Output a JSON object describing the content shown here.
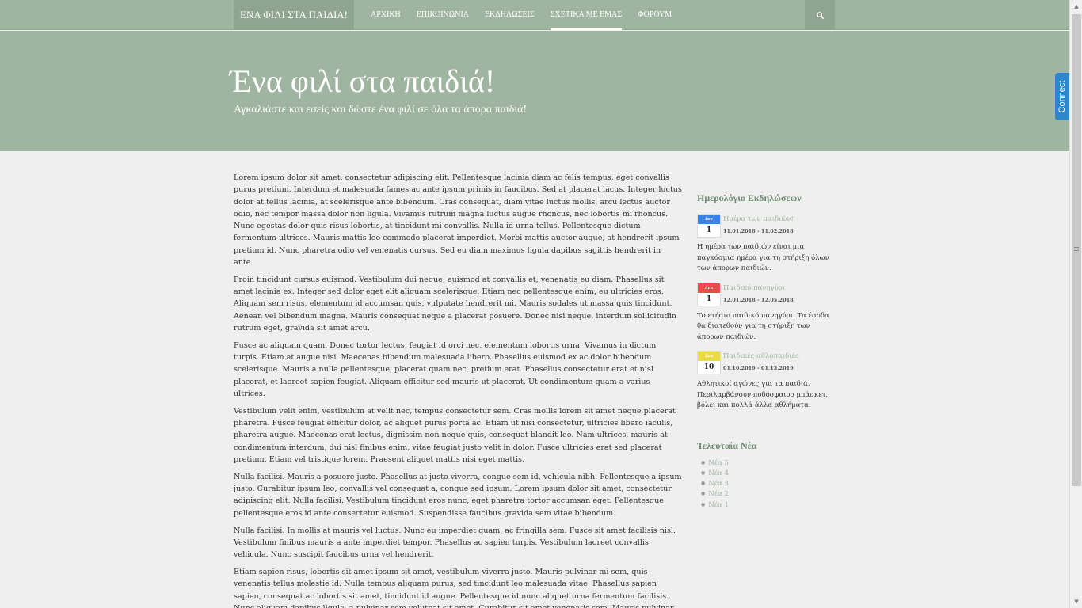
{
  "nav": {
    "brand": "ΕΝΑ ΦΙΛΙ ΣΤΑ ΠΑΙΔΙΑ!",
    "items": [
      {
        "label": "ΑΡΧΙΚΗ"
      },
      {
        "label": "ΕΠΙΚΟΙΝΩΝΙΑ"
      },
      {
        "label": "ΕΚΔΗΛΩΣΕΙΣ"
      },
      {
        "label": "ΣΧΕΤΙΚΑ ΜΕ ΕΜΑΣ"
      },
      {
        "label": "ΦΟΡΟΥΜ"
      }
    ],
    "active": "ΣΧΕΤΙΚΑ ΜΕ ΕΜΑΣ",
    "search_icon": "search-icon"
  },
  "hero": {
    "title": "Ένα φιλί στα παιδιά!",
    "subtitle": "Αγκαλιάστε και εσείς και δώστε ένα φιλί σε όλα τα άπορα παιδιά!"
  },
  "main": {
    "paragraphs": [
      "Lorem ipsum dolor sit amet, consectetur adipiscing elit. Pellentesque lacinia diam ac felis tempus, eget convallis purus pretium. Interdum et malesuada fames ac ante ipsum primis in faucibus. Sed at placerat lacus. Integer luctus dolor at tellus lacinia, at scelerisque ante bibendum. Cras consequat, diam vitae luctus mollis, arcu lectus auctor odio, nec tempor massa dolor non ligula. Vivamus rutrum magna luctus augue rhoncus, nec lobortis mi rhoncus. Nunc egestas dolor quis risus lobortis, at tincidunt mi convallis. Nulla id urna tellus. Pellentesque dictum fermentum ultrices. Mauris mattis leo commodo placerat imperdiet. Morbi mattis auctor augue, at hendrerit ipsum pretium id. Nunc pharetra odio vel venenatis cursus. Sed eu diam maximus ligula dapibus sagittis hendrerit in ante.",
      "Proin tincidunt cursus euismod. Vestibulum dui neque, euismod at convallis et, venenatis eu diam. Phasellus sit amet lacinia ex. Integer sed dolor eget elit aliquam scelerisque. Etiam nec pellentesque enim, eu ultricies eros. Aliquam sem risus, elementum id accumsan quis, vulputate hendrerit mi. Mauris sodales ut massa quis tincidunt. Aenean vel bibendum magna. Mauris consequat neque a placerat posuere. Donec nisi neque, interdum sollicitudin rutrum eget, gravida sit amet arcu.",
      "Fusce ac aliquam quam. Donec tortor lectus, feugiat id orci nec, elementum lobortis urna. Vivamus in dictum turpis. Etiam at augue nisi. Maecenas bibendum malesuada libero. Phasellus euismod ex ac dolor bibendum scelerisque. Mauris a nulla pellentesque, placerat quam nec, pretium erat. Phasellus consectetur erat et nisl placerat, et laoreet sapien feugiat. Aliquam efficitur sed mauris ut placerat. Ut condimentum quam a varius ultrices.",
      "Vestibulum velit enim, vestibulum at velit nec, tempus consectetur sem. Cras mollis lorem sit amet neque placerat pharetra. Fusce feugiat efficitur dolor, ac aliquet purus porta ac. Etiam ut nisi consectetur, ultricies libero iaculis, pharetra augue. Maecenas erat lectus, dignissim non neque quis, consequat blandit leo. Nam ultrices, mauris at condimentum interdum, dui nisl finibus enim, vitae feugiat justo velit in dolor. Fusce ultricies erat sed placerat pretium. Etiam vel tristique lorem. Praesent aliquet mattis nisi eget mattis.",
      "Nulla facilisi. Mauris a posuere justo. Phasellus at justo viverra, congue sem id, vehicula nibh. Pellentesque a ipsum justo. Curabitur ipsum leo, convallis vel consequat a, congue sed ipsum. Lorem ipsum dolor sit amet, consectetur adipiscing elit. Nulla facilisi. Vestibulum tincidunt eros nunc, eget pharetra tortor accumsan eget. Pellentesque pellentesque eros id ante consectetur euismod. Suspendisse faucibus gravida sem vitae bibendum.",
      "Nulla facilisi. In mollis at mauris vel luctus. Nunc eu imperdiet quam, ac fringilla sem. Fusce sit amet facilisis nisl. Vestibulum finibus mauris a ante imperdiet tempor. Phasellus ac sapien turpis. Vestibulum laoreet convallis vehicula. Nunc suscipit faucibus urna vel hendrerit.",
      "Etiam sapien risus, lobortis sit amet ipsum sit amet, vestibulum viverra justo. Mauris pulvinar mi sem, quis venenatis tellus molestie id. Nulla tempus aliquam purus, sed tincidunt leo malesuada vitae. Phasellus sapien sapien, consequat ac lobortis sit amet, tincidunt id augue. Pellentesque id nunc aliquet urna fermentum facilisis. Nunc aliquam dapibus ligula, a pulvinar sem volutpat sit amet. Curabitur sit amet venenatis sem. Mauris pulvinar tempus erat eu eleifend."
    ]
  },
  "sidebar": {
    "events_title": "Ημερολόγιο Εκδηλώσεων",
    "events": [
      {
        "month": "Ιαν",
        "day": "1",
        "color": "#3b82e6",
        "title": "Ημέρα των παιδιών!",
        "dates": "11.01.2018 - 11.02.2018",
        "desc": "Η ημέρα των παιδιών είναι μια παγκόσμια ημέρα για τη στήριξη όλων των άπορων παιδιών."
      },
      {
        "month": "Δεκ",
        "day": "1",
        "color": "#e84d4d",
        "title": "Παιδικό πανηγύρι",
        "dates": "12.01.2018 - 12.05.2018",
        "desc": "Το ετήσιο παιδικό πανηγύρι. Τα έσοδα θα διατεθούν για τη στήριξη των άπορων παιδιών."
      },
      {
        "month": "Σεπ",
        "day": "10",
        "color": "#eadb47",
        "title": "Παιδικές αθλοπαιδιές",
        "dates": "01.10.2019 - 01.13.2019",
        "desc": "Αθλητικοί αγώνες για τα παιδιά. Περιλαμβάνουν ποδόσφαιρο μπάσκετ, βόλει και πολλά άλλα αθλήματα."
      }
    ],
    "news_title": "Τελευταία Νέα",
    "news": [
      {
        "label": "Νέα 5"
      },
      {
        "label": "Νέα 4"
      },
      {
        "label": "Νέα 3"
      },
      {
        "label": "Νέα 2"
      },
      {
        "label": "Νέα 1"
      }
    ]
  },
  "connect_tab": "Connect",
  "colors": {
    "accent": "#9fb5a0",
    "accent_dark": "#8fa590",
    "heading": "#6e8a6f",
    "connect": "#2f86c9"
  }
}
